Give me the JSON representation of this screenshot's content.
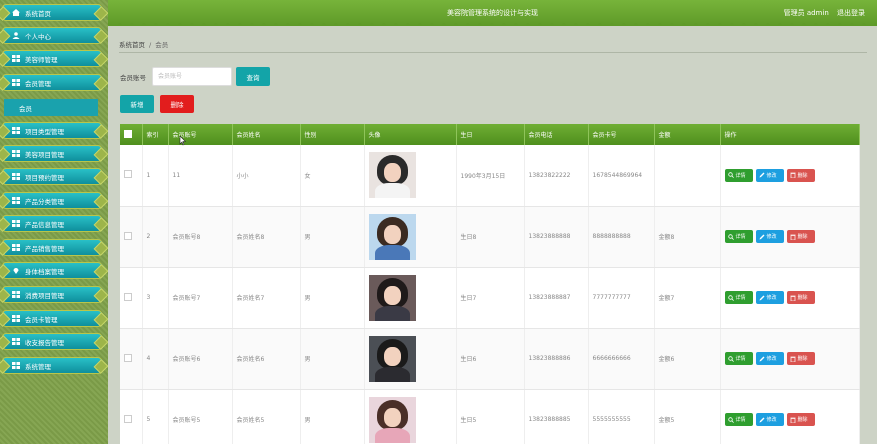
{
  "header": {
    "title": "美容院管理系统的设计与实现",
    "user_label": "管理员 admin",
    "logout_label": "退出登录"
  },
  "sidebar": {
    "items": [
      {
        "label": "系统首页",
        "icon": "home-icon"
      },
      {
        "label": "个人中心",
        "icon": "user-icon"
      },
      {
        "label": "美容师管理",
        "icon": "grid-icon"
      },
      {
        "label": "会员管理",
        "icon": "grid-icon"
      },
      {
        "label": "项目类型管理",
        "icon": "grid-icon"
      },
      {
        "label": "美容项目管理",
        "icon": "grid-icon"
      },
      {
        "label": "项目预约管理",
        "icon": "grid-icon"
      },
      {
        "label": "产品分类管理",
        "icon": "grid-icon"
      },
      {
        "label": "产品信息管理",
        "icon": "grid-icon"
      },
      {
        "label": "产品销售管理",
        "icon": "grid-icon"
      },
      {
        "label": "身体档案管理",
        "icon": "pin-icon"
      },
      {
        "label": "消费项目管理",
        "icon": "grid-icon"
      },
      {
        "label": "会员卡管理",
        "icon": "grid-icon"
      },
      {
        "label": "收支报告管理",
        "icon": "grid-icon"
      },
      {
        "label": "系统管理",
        "icon": "grid-icon"
      }
    ],
    "sub_item": "会员"
  },
  "breadcrumb": {
    "home": "系统首页",
    "separator": "/",
    "current": "会员"
  },
  "search": {
    "label": "会员账号",
    "placeholder": "会员账号",
    "button": "查询"
  },
  "actions": {
    "add": "新增",
    "delete": "删除"
  },
  "table": {
    "headers": [
      "",
      "索引",
      "会员账号",
      "会员姓名",
      "性别",
      "头像",
      "生日",
      "会员电话",
      "会员卡号",
      "金额",
      "操作"
    ],
    "rows": [
      {
        "index": "1",
        "account": "11",
        "name": "小小",
        "gender": "女",
        "birthday": "1990年3月15日",
        "phone": "13823822222",
        "card": "1678544869964",
        "amount": "",
        "avatar": {
          "hair": "#2a2a2a",
          "body": "#f4f4f4",
          "bg": "#e9e3e0"
        }
      },
      {
        "index": "2",
        "account": "会员账号8",
        "name": "会员姓名8",
        "gender": "男",
        "birthday": "生日8",
        "phone": "13823888888",
        "card": "8888888888",
        "amount": "金额8",
        "avatar": {
          "hair": "#3b2b22",
          "body": "#4a78b8",
          "bg": "#bcd8ee"
        }
      },
      {
        "index": "3",
        "account": "会员账号7",
        "name": "会员姓名7",
        "gender": "男",
        "birthday": "生日7",
        "phone": "13823888887",
        "card": "7777777777",
        "amount": "金额7",
        "avatar": {
          "hair": "#1f1a1a",
          "body": "#3a3a45",
          "bg": "#6a5a5a"
        }
      },
      {
        "index": "4",
        "account": "会员账号6",
        "name": "会员姓名6",
        "gender": "男",
        "birthday": "生日6",
        "phone": "13823888886",
        "card": "6666666666",
        "amount": "金额6",
        "avatar": {
          "hair": "#1a1a1a",
          "body": "#2b2b30",
          "bg": "#4b4f55"
        }
      },
      {
        "index": "5",
        "account": "会员账号5",
        "name": "会员姓名5",
        "gender": "男",
        "birthday": "生日5",
        "phone": "13823888885",
        "card": "5555555555",
        "amount": "金额5",
        "avatar": {
          "hair": "#4a2f28",
          "body": "#e7a6b8",
          "bg": "#e9d5dc"
        }
      }
    ],
    "ops": {
      "detail": "详情",
      "edit": "修改",
      "delete": "删除"
    }
  },
  "colors": {
    "header": "#6aa932",
    "sidebar_item": "#1aa2ad",
    "teal_button": "#13a4a8",
    "red_button": "#e21d1d"
  }
}
